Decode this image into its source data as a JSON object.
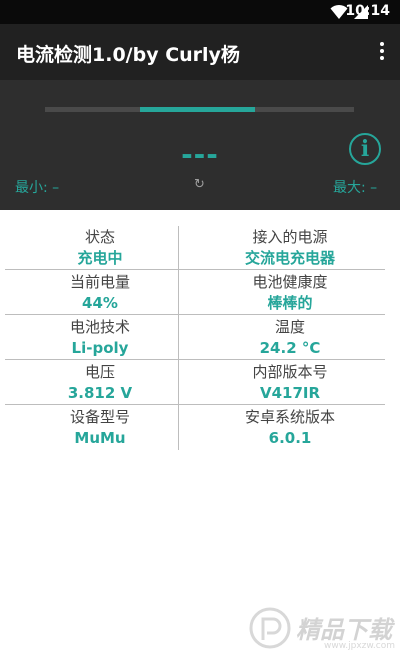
{
  "status_bar": {
    "time": "10:14"
  },
  "app_bar": {
    "title": "电流检测1.0/by Curly杨"
  },
  "panel": {
    "progress": 0.54,
    "current_value": "---",
    "info_label": "i",
    "min_label": "最小: –",
    "max_label": "最大: –",
    "refresh_symbol": "↻"
  },
  "info_rows": [
    {
      "left_label": "状态",
      "left_value": "充电中",
      "right_label": "接入的电源",
      "right_value": "交流电充电器"
    },
    {
      "left_label": "当前电量",
      "left_value": "44%",
      "right_label": "电池健康度",
      "right_value": "棒棒的"
    },
    {
      "left_label": "电池技术",
      "left_value": "Li-poly",
      "right_label": "温度",
      "right_value": "24.2 °C"
    },
    {
      "left_label": "电压",
      "left_value": "3.812 V",
      "right_label": "内部版本号",
      "right_value": "V417IR"
    },
    {
      "left_label": "设备型号",
      "left_value": "MuMu",
      "right_label": "安卓系统版本",
      "right_value": "6.0.1"
    }
  ],
  "watermark": {
    "text": "精品下载",
    "url": "www.jpxzw.com"
  },
  "colors": {
    "accent": "#26a69a",
    "app_bar": "#212121",
    "panel": "#2e2e2e"
  }
}
